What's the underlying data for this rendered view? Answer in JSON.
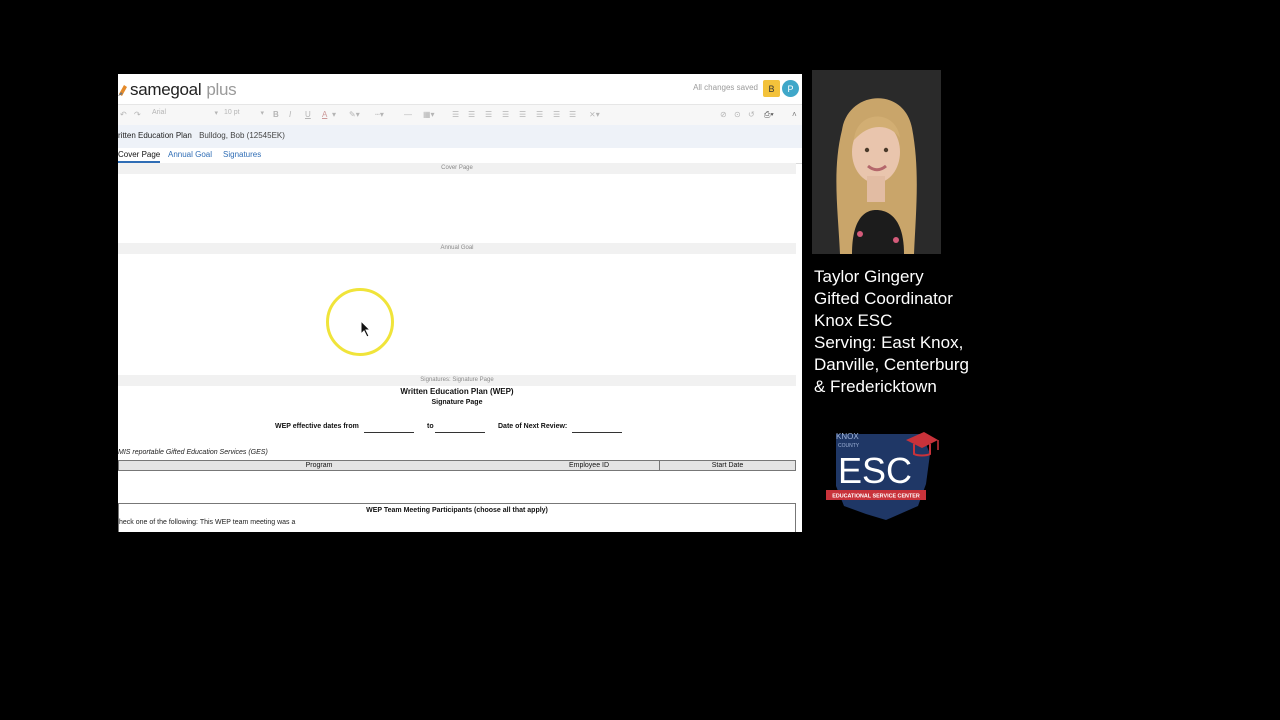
{
  "app": {
    "brand_primary": "samegoal",
    "brand_secondary": "plus",
    "save_status": "All changes saved",
    "avatars": [
      "B",
      "P"
    ],
    "toolbar": {
      "font_family": "Arial",
      "font_size": "10 pt",
      "bold": "B",
      "italic": "I",
      "underline": "U",
      "text_color": "A"
    },
    "document": {
      "title": "ritten Education Plan",
      "student": "Bulldog, Bob (12545EK)"
    },
    "tabs": [
      "Cover Page",
      "Annual Goal",
      "Signatures"
    ],
    "active_tab": "Cover Page",
    "sections": {
      "cover": "Cover Page",
      "annual": "Annual Goal",
      "signatures": "Signatures: Signature Page"
    },
    "wep": {
      "title": "Written Education Plan (WEP)",
      "subtitle": "Signature Page",
      "dates_from_label": "WEP effective dates from",
      "dates_to_label": "to",
      "review_label": "Date of Next Review:",
      "emis_note": "MIS reportable Gifted Education Services (GES)",
      "columns": [
        "Program",
        "Employee ID",
        "Start Date"
      ],
      "team_header": "WEP Team Meeting Participants (choose all that apply)",
      "team_question": "heck one of the following: This WEP team meeting was a"
    }
  },
  "presenter": {
    "name": "Taylor Gingery",
    "role": "Gifted Coordinator",
    "org": "Knox ESC",
    "serving_1": "Serving: East Knox,",
    "serving_2": "Danville, Centerburg",
    "serving_3": "& Fredericktown"
  },
  "esc_logo": {
    "top": "KNOX",
    "county": "COUNTY",
    "main": "ESC",
    "banner": "EDUCATIONAL SERVICE CENTER"
  },
  "colors": {
    "brand_orange": "#e48a2a",
    "link_blue": "#2f6db5",
    "avatar_b": "#f3c23b",
    "avatar_p": "#3fa7c9",
    "cursor_highlight": "#f0e43a",
    "esc_navy": "#1f3766",
    "esc_red": "#c8323a"
  }
}
